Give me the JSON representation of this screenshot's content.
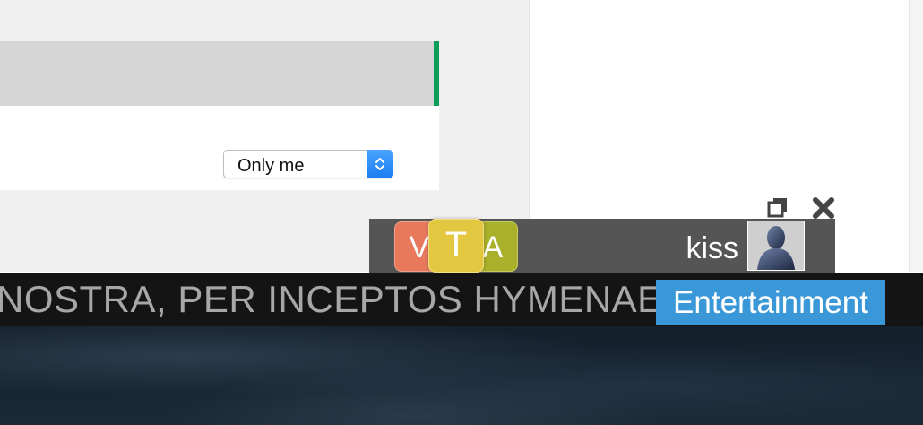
{
  "privacy_select": {
    "value": "Only me"
  },
  "chat_bar": {
    "tiles": [
      "V",
      "T",
      "A"
    ],
    "username": "kiss"
  },
  "ticker": {
    "text": "NOSTRA, PER INCEPTOS HYMENAEOS",
    "category": "Entertainment"
  },
  "colors": {
    "accent_green": "#0e9d58",
    "badge_blue": "#3a98d8",
    "tile_v": "#e8795d",
    "tile_t": "#e3c740",
    "tile_a": "#a9b12a"
  },
  "icons": {
    "restore": "restore-window-icon",
    "close": "close-icon",
    "select_arrows": "up-down-chevron-icon",
    "avatar": "default-user-avatar"
  }
}
